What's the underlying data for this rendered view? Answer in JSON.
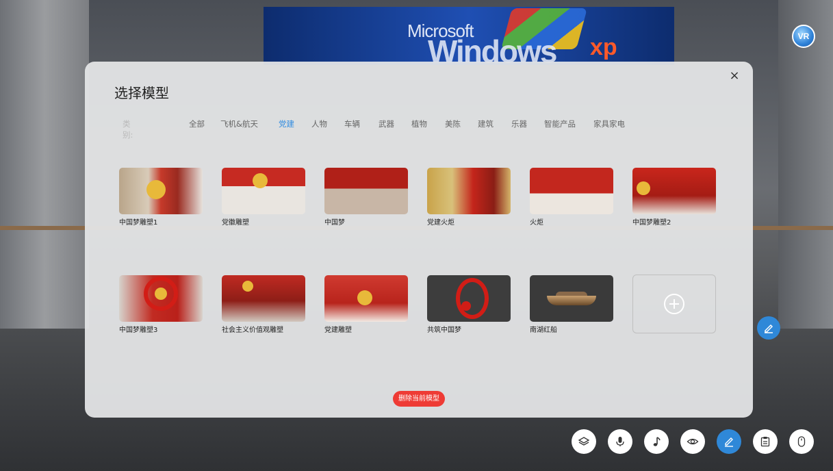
{
  "modal": {
    "title": "选择模型",
    "close_label": "×",
    "category_label": "类别:",
    "categories": [
      "全部",
      "飞机&航天",
      "党建",
      "人物",
      "车辆",
      "武器",
      "植物",
      "美陈",
      "建筑",
      "乐器",
      "智能产品",
      "家具家电"
    ],
    "active_category": "党建",
    "models": [
      {
        "name": "中国梦雕塑1"
      },
      {
        "name": "党徽雕塑"
      },
      {
        "name": "中国梦"
      },
      {
        "name": "党建火炬"
      },
      {
        "name": "火炬"
      },
      {
        "name": "中国梦雕塑2"
      },
      {
        "name": "中国梦雕塑3"
      },
      {
        "name": "社会主义价值观雕塑"
      },
      {
        "name": "党建雕塑"
      },
      {
        "name": "共筑中国梦"
      },
      {
        "name": "南湖红船"
      }
    ],
    "add_icon": "plus-circle-icon",
    "delete_label": "删除当前模型"
  },
  "scene": {
    "screen_text_line1": "Microsoft",
    "screen_text_line2": "Windows",
    "screen_text_xp": "xp",
    "logo_text": "VR"
  },
  "toolbar": {
    "buttons": [
      {
        "icon": "layers-icon"
      },
      {
        "icon": "microphone-icon"
      },
      {
        "icon": "music-note-icon"
      },
      {
        "icon": "eye-icon"
      },
      {
        "icon": "edit-pencil-icon",
        "active": true
      },
      {
        "icon": "clipboard-icon"
      },
      {
        "icon": "mouse-icon"
      }
    ]
  },
  "colors": {
    "accent": "#2f8be0",
    "danger": "#ee3b35",
    "modal_bg": "#e4e5e7"
  }
}
